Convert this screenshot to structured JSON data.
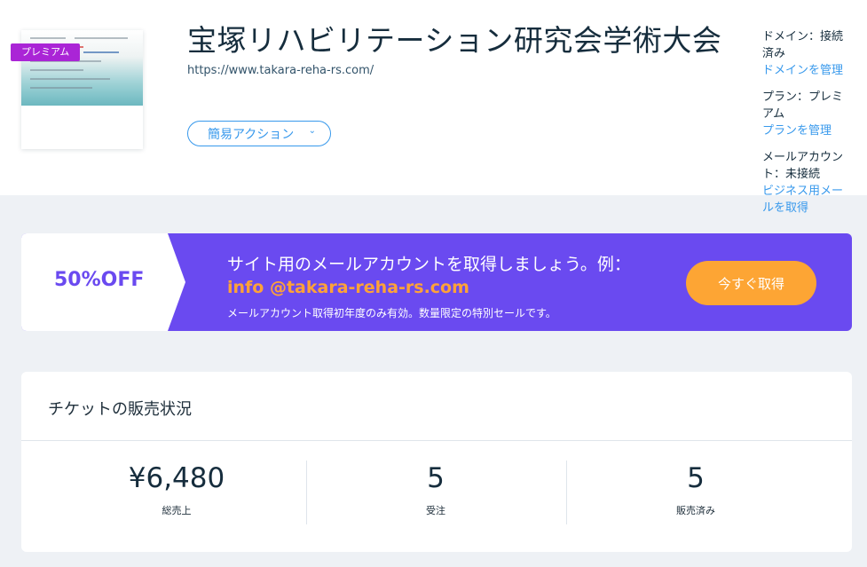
{
  "header": {
    "premium_badge": "プレミアム",
    "site_title": "宝塚リハビリテーション研究会学術大会",
    "site_url": "https://www.takara-reha-rs.com/",
    "quick_actions_label": "簡易アクション",
    "domain": {
      "label": "ドメイン：接続済み",
      "link": "ドメインを管理"
    },
    "plan": {
      "label": "プラン：プレミアム",
      "link": "プランを管理"
    },
    "mail": {
      "label": "メールアカウント：未接続",
      "link": "ビジネス用メールを取得"
    }
  },
  "promo": {
    "discount": "50%OFF",
    "headline": "サイト用のメールアカウントを取得しましょう。例：",
    "email_example": "info @takara-reha-rs.com",
    "note": "メールアカウント取得初年度のみ有効。数量限定の特別セールです。",
    "button_label": "今すぐ取得"
  },
  "sales": {
    "title": "チケットの販売状況",
    "stats": [
      {
        "value": "¥6,480",
        "label": "総売上"
      },
      {
        "value": "5",
        "label": "受注"
      },
      {
        "value": "5",
        "label": "販売済み"
      }
    ]
  },
  "colors": {
    "accent_blue": "#3899ec",
    "premium_purple": "#aa25d6",
    "promo_purple": "#6a4af0",
    "promo_orange": "#fda534"
  }
}
